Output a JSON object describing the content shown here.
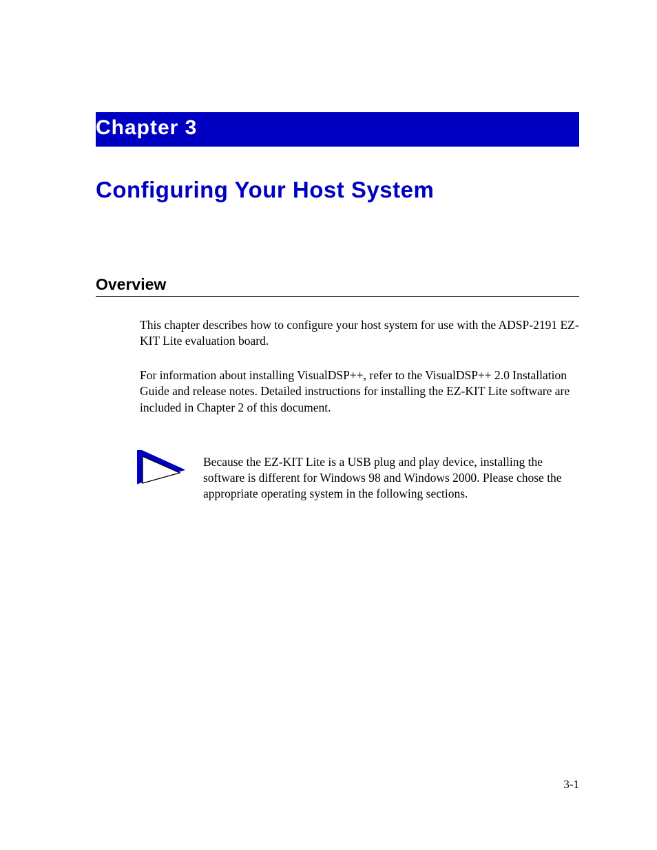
{
  "chapter": {
    "number": "Chapter 3",
    "title": "Configuring Your Host System"
  },
  "section": {
    "title": "Overview"
  },
  "paragraphs": {
    "p1": "This chapter describes how to configure your host system for use with the ADSP-2191 EZ-KIT Lite evaluation board.",
    "p2": "For information about installing VisualDSP++, refer to the VisualDSP++ 2.0 Installation Guide and release notes. Detailed instructions for installing the EZ-KIT Lite software are included in Chapter 2 of this document."
  },
  "note": {
    "text": "Because the EZ-KIT Lite is a USB plug and play device, installing the software is different for Windows 98 and Windows 2000. Please chose the appropriate operating system in the following sections."
  },
  "footer": {
    "page": "3-1"
  }
}
